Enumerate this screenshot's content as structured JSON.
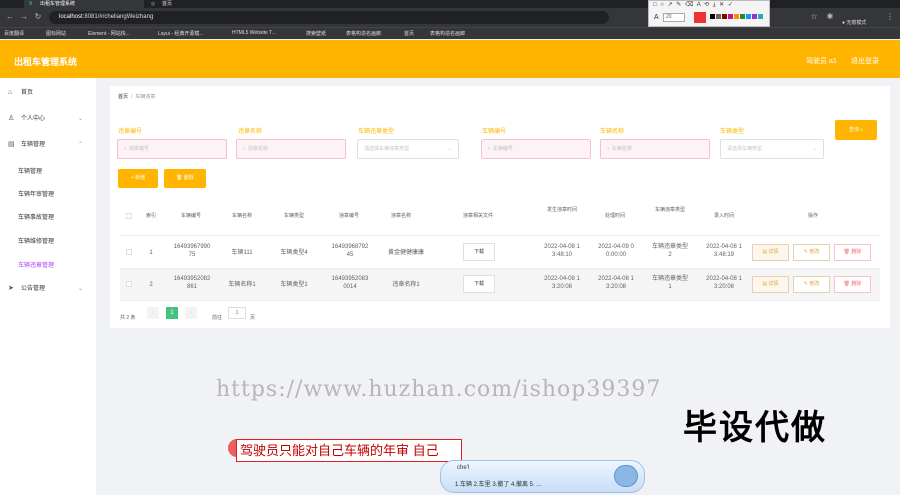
{
  "browser": {
    "tabs": [
      {
        "title": "出租车管理系统",
        "active": true
      },
      {
        "title": "首页",
        "active": false
      }
    ],
    "url_host": "localhost",
    "url_rest": ":8081/#/cheliangWeizhang",
    "profile_label": "无痕模式",
    "bookmarks": [
      "百度翻译",
      "图标网站",
      "Element - 网站快...",
      "Layui - 经典开源模...",
      "HTML5 Website T...",
      "搜索壁纸",
      "表格构造名画廊",
      "首页",
      "表格构造名画廊"
    ]
  },
  "screenshot_tool": {
    "font_size": "20"
  },
  "header": {
    "title": "出租车管理系统",
    "user": "驾驶员 a1",
    "logout": "退出登录"
  },
  "sidebar": {
    "home": "首页",
    "personal": "个人中心",
    "vehicle": "车辆管理",
    "vehicle_children": [
      "车辆管理",
      "车辆年审管理",
      "车辆事故管理",
      "车辆维修管理",
      "车辆违章管理"
    ],
    "notice": "公告管理"
  },
  "breadcrumb": {
    "home": "首页",
    "current": "车辆违章"
  },
  "filters": {
    "labels": [
      "违章编号",
      "违章名称",
      "车辆违章类型",
      "车辆编号",
      "车辆名称",
      "车辆类型"
    ],
    "placeholders": [
      "违章编号",
      "违章名称",
      "请选择车辆违章类型",
      "车辆编号",
      "车辆名称",
      "请选择车辆类型"
    ],
    "search_btn": "查询"
  },
  "actions": {
    "add": "新增",
    "delete": "删除"
  },
  "table": {
    "headers": [
      "索引",
      "车辆编号",
      "车辆名称",
      "车辆类型",
      "违章编号",
      "违章名称",
      "违章相关文件",
      "发生违章时间",
      "处理时间",
      "车辆违章类型",
      "录入时间",
      "操作"
    ],
    "download": "下载",
    "ops": {
      "detail": "详情",
      "edit": "修改",
      "delete": "删除"
    },
    "rows": [
      {
        "index": "1",
        "car_no_1": "16493967990",
        "car_no_2": "75",
        "car_name": "车辆111",
        "car_type": "车辆类型4",
        "vio_no_1": "16493968792",
        "vio_no_2": "45",
        "vio_name": "黄金健健康康",
        "time_1": "2022-04-08 1",
        "time_2": "3:48:10",
        "handle_1": "2022-04-09 0",
        "handle_2": "0:00:00",
        "vio_type_1": "车辆违章类型",
        "vio_type_2": "2",
        "entry_1": "2022-04-08 1",
        "entry_2": "3:48:19"
      },
      {
        "index": "2",
        "car_no_1": "16493952082",
        "car_no_2": "861",
        "car_name": "车辆名称1",
        "car_type": "车辆类型1",
        "vio_no_1": "16493952083",
        "vio_no_2": "0014",
        "vio_name": "违章名称1",
        "time_1": "2022-04-08 1",
        "time_2": "3:20:08",
        "handle_1": "2022-04-08 1",
        "handle_2": "3:20:08",
        "vio_type_1": "车辆违章类型",
        "vio_type_2": "1",
        "entry_1": "2022-04-08 1",
        "entry_2": "3:20:08"
      }
    ]
  },
  "pagination": {
    "total": "共 2 条",
    "current": "1",
    "goto_prefix": "前往",
    "goto_value": "1",
    "goto_suffix": "页"
  },
  "overlay": {
    "watermark": "https://www.huzhan.com/ishop39397",
    "stamp": "毕设代做",
    "ime_text": "驾驶员只能对自己车辆的年审 自己",
    "ime_pinyin": "che'l",
    "ime_candidates": "1.车辆  2.车里  3.撤了  4.撤离  5. ..."
  }
}
